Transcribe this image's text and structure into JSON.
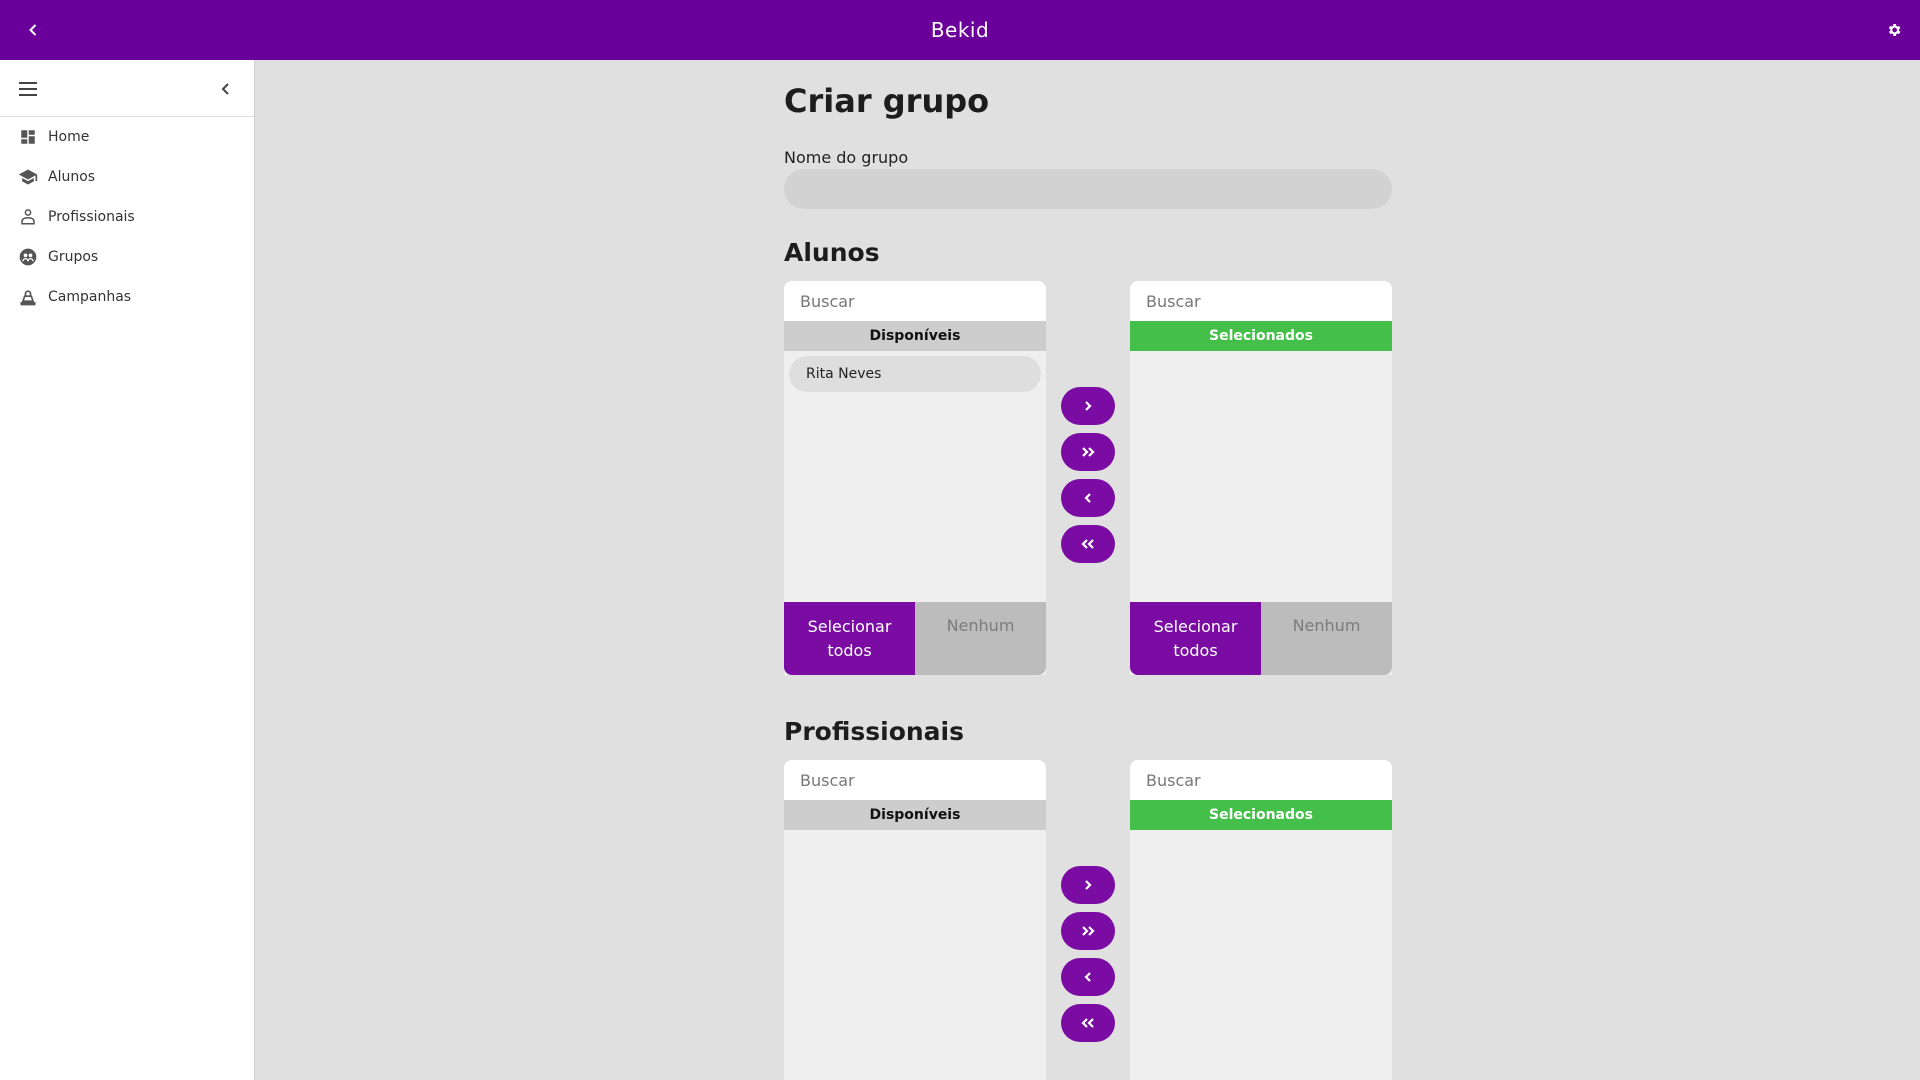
{
  "app": {
    "title": "Bekid"
  },
  "sidebar": {
    "items": [
      {
        "label": "Home",
        "icon": "dashboard-icon"
      },
      {
        "label": "Alunos",
        "icon": "school-icon"
      },
      {
        "label": "Profissionais",
        "icon": "professional-icon"
      },
      {
        "label": "Grupos",
        "icon": "groups-icon"
      },
      {
        "label": "Campanhas",
        "icon": "campaign-icon"
      }
    ]
  },
  "page": {
    "title": "Criar grupo",
    "name_label": "Nome do grupo",
    "name_value": ""
  },
  "colors": {
    "primary": "#6a0099",
    "accent_button": "#7a0ca3",
    "selected_header": "#44c04a"
  },
  "alunos": {
    "title": "Alunos",
    "available": {
      "search_placeholder": "Buscar",
      "header": "Disponíveis",
      "items": [
        "Rita Neves"
      ],
      "select_all": "Selecionar todos",
      "none": "Nenhum"
    },
    "selected": {
      "search_placeholder": "Buscar",
      "header": "Selecionados",
      "items": [],
      "select_all": "Selecionar todos",
      "none": "Nenhum"
    }
  },
  "profissionais": {
    "title": "Profissionais",
    "available": {
      "search_placeholder": "Buscar",
      "header": "Disponíveis",
      "items": []
    },
    "selected": {
      "search_placeholder": "Buscar",
      "header": "Selecionados",
      "items": []
    }
  }
}
